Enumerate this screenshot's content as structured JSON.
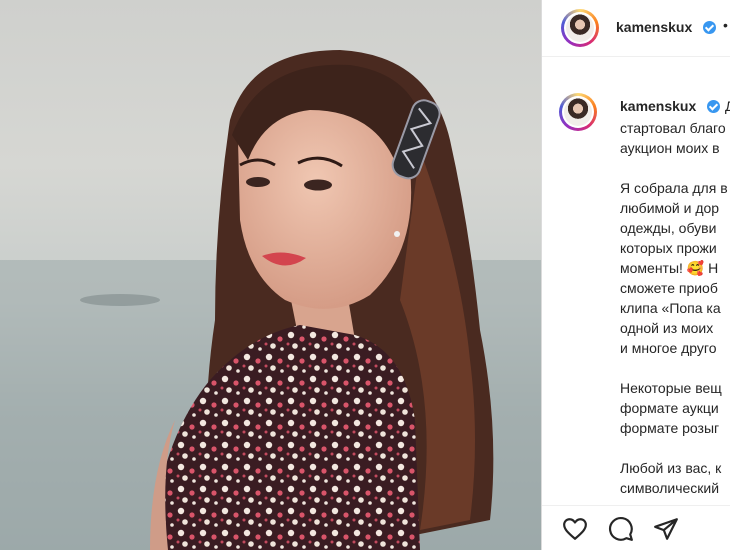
{
  "post": {
    "username": "kamenskux",
    "header_more": "•",
    "caption_first": "Д",
    "caption_lines": [
      "стартовал благо",
      "аукцион моих в",
      "",
      "Я собрала для в",
      "любимой и дор",
      "одежды, обуви",
      "которых прожи",
      "моменты! 🥰 Н",
      "сможете приоб",
      "клипа «Попа ка",
      "одной из моих",
      "и многое друго",
      "",
      "Некоторые вещ",
      "формате аукци",
      "формате розыг",
      "",
      "Любой из вас, к",
      "символический"
    ]
  },
  "actions": {
    "like": "heart-icon",
    "comment": "comment-icon",
    "share": "share-icon"
  },
  "colors": {
    "verified": "#3897f0",
    "text": "#262626",
    "border": "#dbdbdb"
  }
}
